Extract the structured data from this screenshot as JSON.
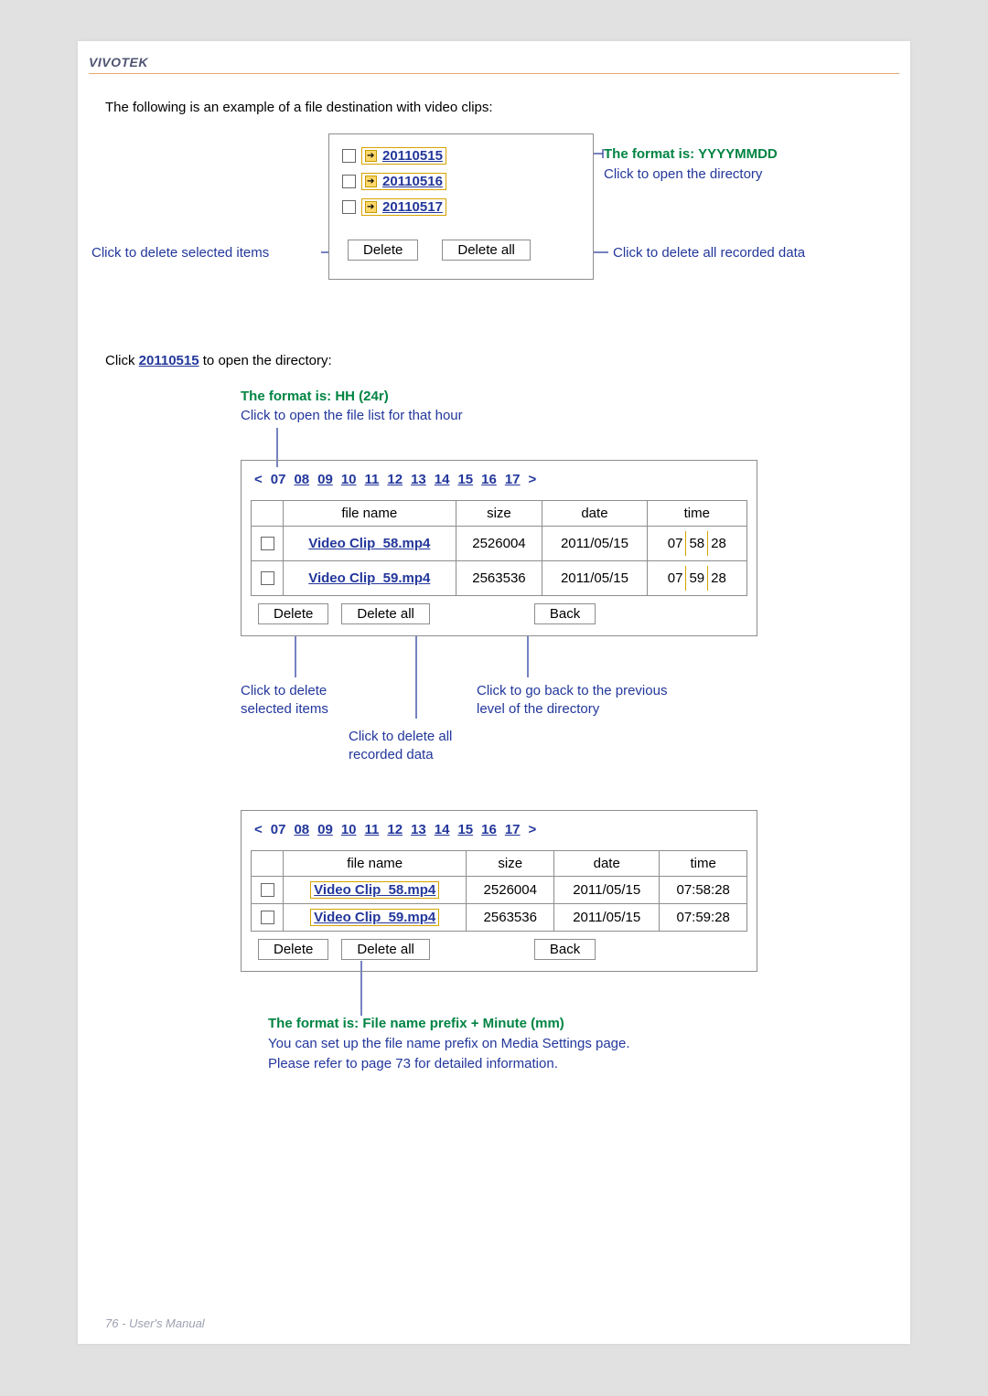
{
  "brand": "VIVOTEK",
  "footer": "76 - User's Manual",
  "intro": "The following is an example of a file destination with video clips:",
  "panel1": {
    "items": [
      "20110515",
      "20110516",
      "20110517"
    ],
    "delete": "Delete",
    "delete_all": "Delete all"
  },
  "labels": {
    "delete_selected": "Click to delete selected items",
    "format_head": "The format is: YYYYMMDD",
    "format_sub": "Click to open the directory",
    "delete_all": "Click to delete all recorded data"
  },
  "section2": {
    "line1a": "Click ",
    "line1b": "20110515",
    "line1c": " to open the directory:",
    "hh_head": "The format is: HH (24r)",
    "hh_sub": "Click to open the file list for that hour",
    "hours_current": "07",
    "hours": [
      "08",
      "09",
      "10",
      "11",
      "12",
      "13",
      "14",
      "15",
      "16",
      "17"
    ],
    "lt": "<",
    "gt": ">",
    "th_name": "file name",
    "th_size": "size",
    "th_date": "date",
    "th_time": "time",
    "rows": [
      {
        "name": "Video Clip_58.mp4",
        "size": "2526004",
        "date": "2011/05/15",
        "t_h": "07",
        "t_m": "58",
        "t_s": "28"
      },
      {
        "name": "Video Clip_59.mp4",
        "size": "2563536",
        "date": "2011/05/15",
        "t_h": "07",
        "t_m": "59",
        "t_s": "28"
      }
    ],
    "delete": "Delete",
    "delete_all": "Delete all",
    "back": "Back",
    "note1a": "Click to delete",
    "note1b": "selected items",
    "note2a": "Click to delete all",
    "note2b": "recorded data",
    "note3a": "Click to go back to the previous",
    "note3b": "level of the directory"
  },
  "section3": {
    "hours_current": "07",
    "hours": [
      "08",
      "09",
      "10",
      "11",
      "12",
      "13",
      "14",
      "15",
      "16",
      "17"
    ],
    "th_name": "file name",
    "th_size": "size",
    "th_date": "date",
    "th_time": "time",
    "rows": [
      {
        "name": "Video Clip_58.mp4",
        "size": "2526004",
        "date": "2011/05/15",
        "time": "07:58:28"
      },
      {
        "name": "Video Clip_59.mp4",
        "size": "2563536",
        "date": "2011/05/15",
        "time": "07:59:28"
      }
    ],
    "delete": "Delete",
    "delete_all": "Delete all",
    "back": "Back",
    "fn_head": "The format is: File name prefix + Minute (mm)",
    "fn_l1": "You can set up the file name prefix on Media Settings page.",
    "fn_l2": "Please refer to page 73 for detailed information."
  }
}
